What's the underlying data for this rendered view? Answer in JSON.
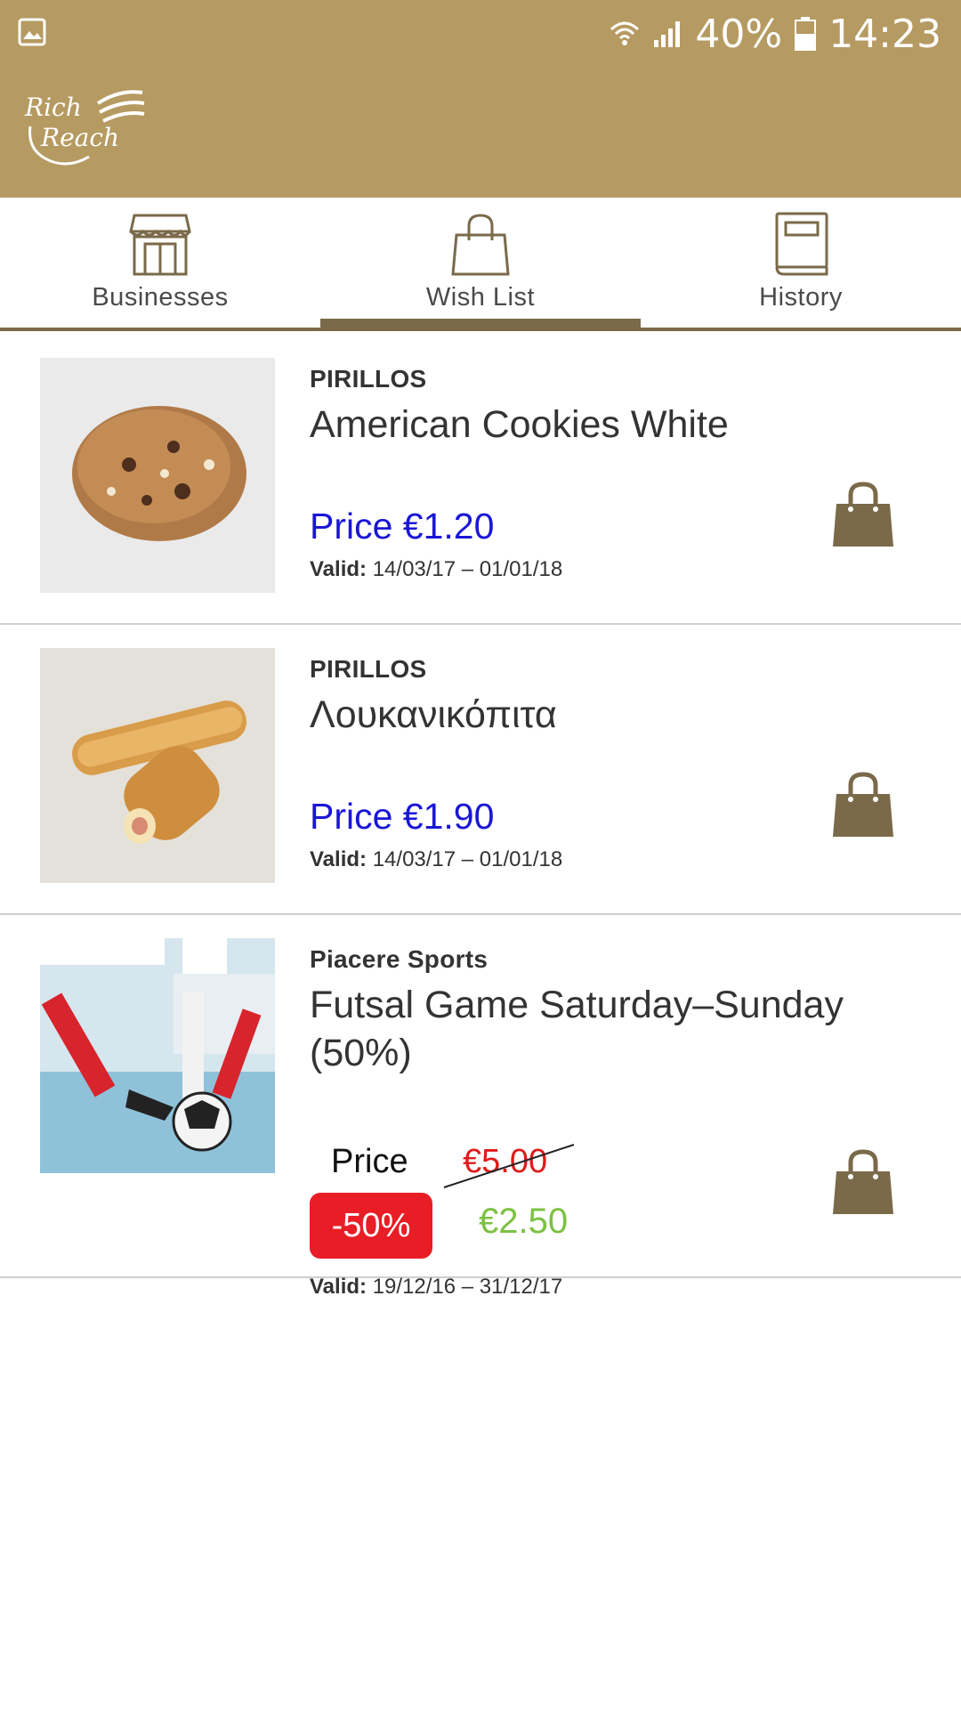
{
  "status_bar": {
    "battery": "40%",
    "time": "14:23"
  },
  "header": {
    "logo_text": "Rich Reach"
  },
  "tabs": [
    {
      "label": "Businesses",
      "icon": "storefront-icon",
      "active": false
    },
    {
      "label": "Wish List",
      "icon": "shopping-bag-icon",
      "active": true
    },
    {
      "label": "History",
      "icon": "book-icon",
      "active": false
    }
  ],
  "items": [
    {
      "business": "PIRILLOS",
      "title": "American Cookies White",
      "price": "Price €1.20",
      "valid_label": "Valid:",
      "valid_dates": "14/03/17 – 01/01/18",
      "image": "cookie"
    },
    {
      "business": "PIRILLOS",
      "title": "Λουκανικόπιτα",
      "price": "Price €1.90",
      "valid_label": "Valid:",
      "valid_dates": "14/03/17 – 01/01/18",
      "image": "sausage-roll"
    },
    {
      "business": "Piacere Sports",
      "title": "Futsal Game Saturday–Sunday (50%)",
      "price_label": "Price",
      "old_price": "€5.00",
      "discount": "-50%",
      "new_price": "€2.50",
      "valid_label": "Valid:",
      "valid_dates": "19/12/16 – 31/12/17",
      "image": "futsal"
    }
  ],
  "colors": {
    "header": "#b59a62",
    "accent": "#7a6a4a",
    "price_blue": "#1a16d6",
    "old_price_red": "#e11b1b",
    "badge_red": "#e81d25",
    "new_price_green": "#7cc142"
  }
}
